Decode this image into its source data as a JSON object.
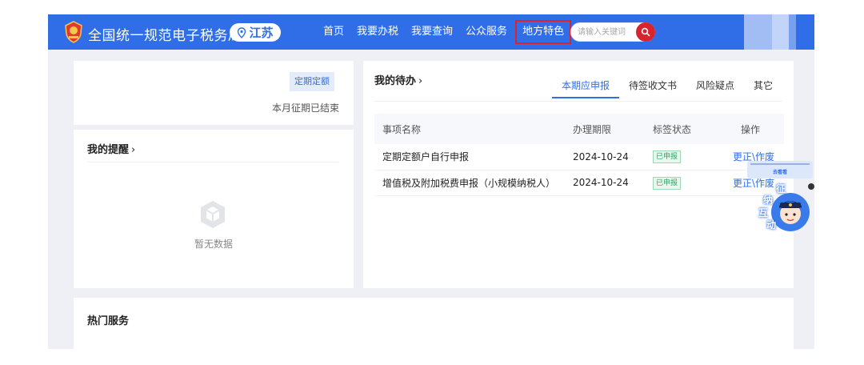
{
  "header": {
    "site_title": "全国统一规范电子税务局",
    "region": "江苏",
    "nav": [
      "首页",
      "我要办税",
      "我要查询",
      "公众服务",
      "地方特色"
    ],
    "search_placeholder": "请输入关键词"
  },
  "quota": {
    "tag": "定期定额",
    "status": "本月征期已结束"
  },
  "reminders": {
    "title": "我的提醒",
    "empty_text": "暂无数据"
  },
  "todo": {
    "title": "我的待办",
    "tabs": [
      "本期应申报",
      "待签收文书",
      "风险疑点",
      "其它"
    ],
    "columns": [
      "事项名称",
      "办理期限",
      "标签状态",
      "操作"
    ],
    "rows": [
      {
        "name": "定期定额户自行申报",
        "deadline": "2024-10-24",
        "status": "已申报",
        "action": "更正\\作废"
      },
      {
        "name": "增值税及附加税费申报（小规模纳税人）",
        "deadline": "2024-10-24",
        "status": "已申报",
        "action": "更正\\作废"
      }
    ]
  },
  "hot_services": {
    "title": "热门服务"
  },
  "assistant": {
    "bubble_text": "去看看",
    "chars": [
      "征",
      "纳",
      "互",
      "动"
    ]
  },
  "colors": {
    "primary": "#2f6ee6",
    "accent_red": "#d9232e",
    "status_green": "#2ba562"
  }
}
